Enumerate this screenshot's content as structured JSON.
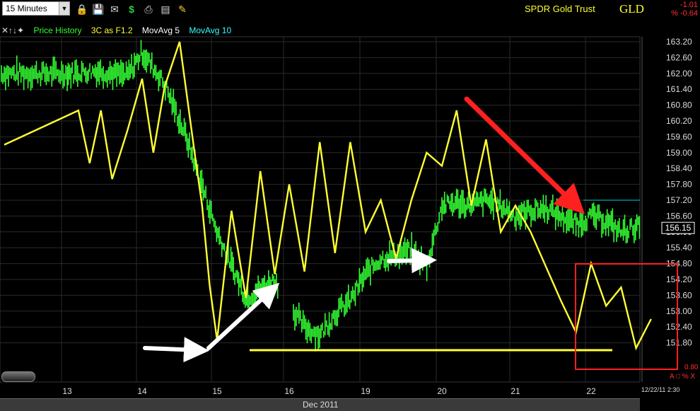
{
  "toolbar": {
    "interval": "15 Minutes",
    "symbol_name": "SPDR Gold Trust",
    "symbol": "GLD",
    "change": "-1.01",
    "change_pct": "% -0.64"
  },
  "legend": {
    "items": [
      {
        "label": "Price History",
        "color": "#33ff33"
      },
      {
        "label": "3C as F1.2",
        "color": "#ffff33"
      },
      {
        "label": "MovAvg 5",
        "color": "#ffffff"
      },
      {
        "label": "MovAvg 10",
        "color": "#33ffff"
      }
    ]
  },
  "icons": [
    "legend-icon",
    "lock-icon",
    "save-icon",
    "mail-icon",
    "dollar-icon",
    "print-icon",
    "screen-icon",
    "pencil-icon"
  ],
  "colors": {
    "price": "#33ff33",
    "indicator": "#ffff33",
    "arrow_up": "#ffffff",
    "arrow_down": "#ff2020",
    "box": "#ff2020",
    "ma": "#00aaaa"
  },
  "chart_data": {
    "type": "line",
    "title": "SPDR Gold Trust",
    "xlabel": "Dec 2011",
    "ylabel": "",
    "categories": [
      "13",
      "14",
      "15",
      "16",
      "19",
      "20",
      "21",
      "22"
    ],
    "ylim": [
      151.5,
      163.5
    ],
    "y_ticks": [
      "163.20",
      "162.60",
      "162.00",
      "161.40",
      "160.80",
      "160.20",
      "159.60",
      "159.00",
      "158.40",
      "157.80",
      "157.20",
      "156.60",
      "156.00",
      "155.40",
      "154.80",
      "154.20",
      "153.60",
      "153.00",
      "152.40",
      "151.80"
    ],
    "last_price": "156.15",
    "series": [
      {
        "name": "Price History",
        "x": [
          0,
          0.4,
          0.8,
          1.0,
          1.3,
          1.6,
          2.0,
          2.4,
          2.8,
          3.0,
          3.2,
          3.4,
          3.6,
          3.8,
          4.0,
          4.2,
          4.4,
          4.6,
          4.8,
          5.0,
          5.2,
          5.4,
          5.6,
          5.8,
          6.0,
          6.2,
          6.4,
          6.6,
          6.8,
          7.0,
          7.2,
          7.4,
          7.6,
          7.8
        ],
        "y": [
          162.0,
          162.1,
          161.9,
          162.8,
          161.6,
          159.5,
          156.0,
          153.5,
          154.2,
          153.2,
          152.4,
          152.1,
          152.9,
          153.4,
          154.4,
          155.0,
          155.1,
          155.3,
          154.7,
          157.0,
          157.1,
          157.0,
          157.2,
          157.0,
          156.6,
          156.8,
          156.9,
          156.6,
          156.3,
          156.6,
          156.4,
          156.0,
          156.2,
          156.1
        ]
      },
      {
        "name": "3C as F1.2",
        "x": [
          0,
          0.15,
          0.3,
          0.45,
          0.6,
          0.8,
          1.0,
          1.15,
          1.3,
          1.5,
          1.7,
          1.8,
          1.9,
          2.0,
          2.2,
          2.4,
          2.6,
          2.8,
          3.0,
          3.2,
          3.4,
          3.6,
          3.8,
          4.0,
          4.2,
          4.4,
          4.6,
          4.8,
          5.0,
          5.2,
          5.4,
          5.6,
          5.8,
          6.0,
          6.2,
          6.4,
          6.6,
          6.8,
          7.0,
          7.2,
          7.4,
          7.6,
          7.8
        ],
        "y": [
          159.3,
          160.6,
          158.6,
          160.6,
          158.0,
          159.8,
          161.8,
          159.0,
          161.5,
          163.2,
          159.0,
          157.0,
          154.0,
          151.9,
          156.8,
          153.5,
          158.3,
          154.4,
          157.8,
          154.5,
          159.4,
          155.2,
          159.4,
          156.0,
          157.2,
          155.0,
          157.2,
          159.0,
          158.5,
          160.6,
          157.0,
          159.5,
          156.0,
          157.0,
          156.0,
          154.7,
          153.4,
          152.2,
          154.8,
          153.2,
          153.9,
          151.6,
          152.7
        ]
      },
      {
        "name": "MovAvg 10",
        "x": [
          6.9,
          7.9
        ],
        "y": [
          157.2,
          157.2
        ]
      }
    ],
    "annotations": [
      "white arrow 14-15",
      "white arrow 15-16",
      "white arrow 19-20",
      "red arrow 20-22",
      "yellow support line",
      "red box"
    ]
  },
  "footer": {
    "date_label": "Dec 2011",
    "timestamp": "12/22/11 2:30",
    "scale_low": "0.80",
    "scale_controls": "A □ % X"
  }
}
